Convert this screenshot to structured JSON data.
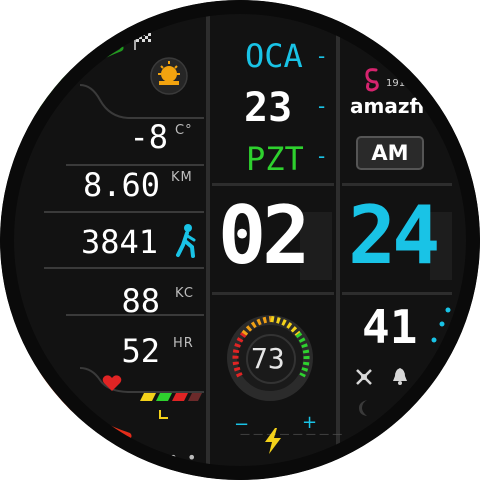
{
  "weather": {
    "temperature": "-8",
    "unit": "C°",
    "icon": "sun-icon"
  },
  "stats": [
    {
      "value": "8.60",
      "unit": "KM"
    },
    {
      "value": "3841",
      "unit": "",
      "icon": "walking-person-icon"
    },
    {
      "value": "88",
      "unit": "KC"
    },
    {
      "value": "52",
      "unit": "HR",
      "icon": "heart-icon"
    }
  ],
  "date": {
    "month": "OCA",
    "day": "23",
    "weekday": "PZT"
  },
  "brand": {
    "name": "amazfit",
    "code": "191"
  },
  "period": "AM",
  "time": {
    "hours": "02",
    "minutes": "24",
    "seconds": "41"
  },
  "battery": {
    "level": 73,
    "minus": "−",
    "plus": "+"
  },
  "colors": {
    "cyan": "#19c3e6",
    "green": "#2ed12e",
    "yellow": "#f3d11a",
    "red": "#e02424",
    "brand_pink": "#d6246e"
  },
  "icons": [
    "checkered-flag-icon",
    "sun-icon",
    "walking-person-icon",
    "heart-icon",
    "bolt-icon",
    "alarm-icon",
    "moon-icon",
    "bell-icon"
  ]
}
